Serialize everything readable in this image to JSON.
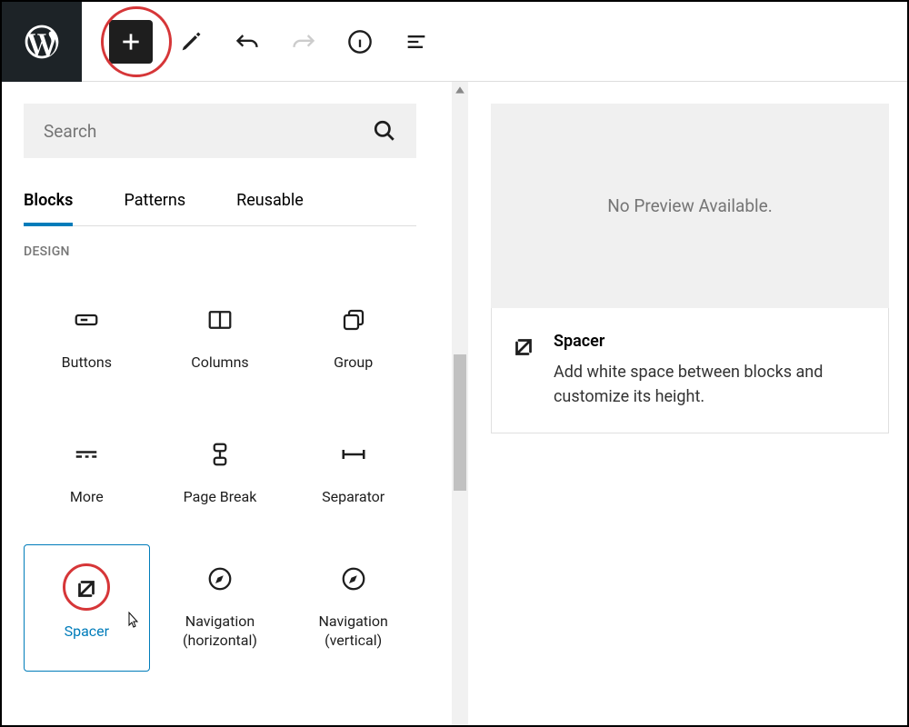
{
  "search": {
    "placeholder": "Search"
  },
  "tabs": {
    "blocks": "Blocks",
    "patterns": "Patterns",
    "reusable": "Reusable"
  },
  "category": "DESIGN",
  "blocks": {
    "buttons": "Buttons",
    "columns": "Columns",
    "group": "Group",
    "more": "More",
    "pagebreak": "Page Break",
    "separator": "Separator",
    "spacer": "Spacer",
    "navh": "Navigation (horizontal)",
    "navv": "Navigation (vertical)"
  },
  "preview": {
    "placeholder": "No Preview Available.",
    "title": "Spacer",
    "description": "Add white space between blocks and customize its height."
  }
}
